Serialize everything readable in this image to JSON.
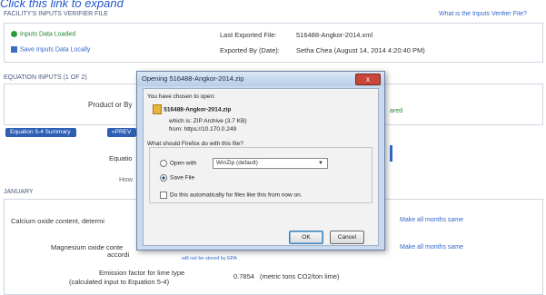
{
  "instruction": "Click this link to expand",
  "page": {
    "facility_title": "FACILITY'S INPUTS VERIFIER FILE",
    "what_is_link": "What is the Inputs Verifier File?",
    "status_loaded": "Inputs Data Loaded",
    "save_locally": "Save Inputs Data Locally",
    "last_exported_label": "Last Exported File:",
    "last_exported_value": "516488-Angkor-2014.xml",
    "exported_by_label": "Exported By (Date):",
    "exported_by_value": "Setha Chea (August 14, 2014 4:20:40 PM)",
    "equation_inputs_title": "EQUATION INPUTS (1 OF 2)",
    "product_label": "Product or By",
    "ared_text": "ared",
    "tab_summary": "Equation 5-4 Summary",
    "tab_other": "«PREV",
    "equation_label": "Equatio",
    "how_label": "How",
    "january_label": "JANUARY",
    "calcium_label": "Calcium oxide content, determi",
    "make_all_1": "Make all months same",
    "magnesium_label": "Magnesium oxide conte",
    "magnesium_label2": "accordi",
    "make_all_2": "Make all months same",
    "not_stored": "will not be stored by EPA",
    "emission_label": "Emission factor for lime type",
    "emission_label2": "(calculated input to Equation 5-4)",
    "emission_value": "0.7854",
    "emission_units": "(metric tons CO2/ton lime)"
  },
  "dialog": {
    "title": "Opening 516488-Angkor-2014.zip",
    "close_label": "x",
    "chosen_text": "You have chosen to open:",
    "filename": "516488-Angkor-2014.zip",
    "which_is": "which is: ZIP Archive (3.7 KB)",
    "from": "from: https://10.170.0.249",
    "question": "What should Firefox do with this file?",
    "open_with_label": "Open with",
    "open_with_value": "WinZip (default)",
    "save_file_label": "Save File",
    "auto_label": "Do this automatically for files like this from now on.",
    "ok_label": "OK",
    "cancel_label": "Cancel"
  }
}
